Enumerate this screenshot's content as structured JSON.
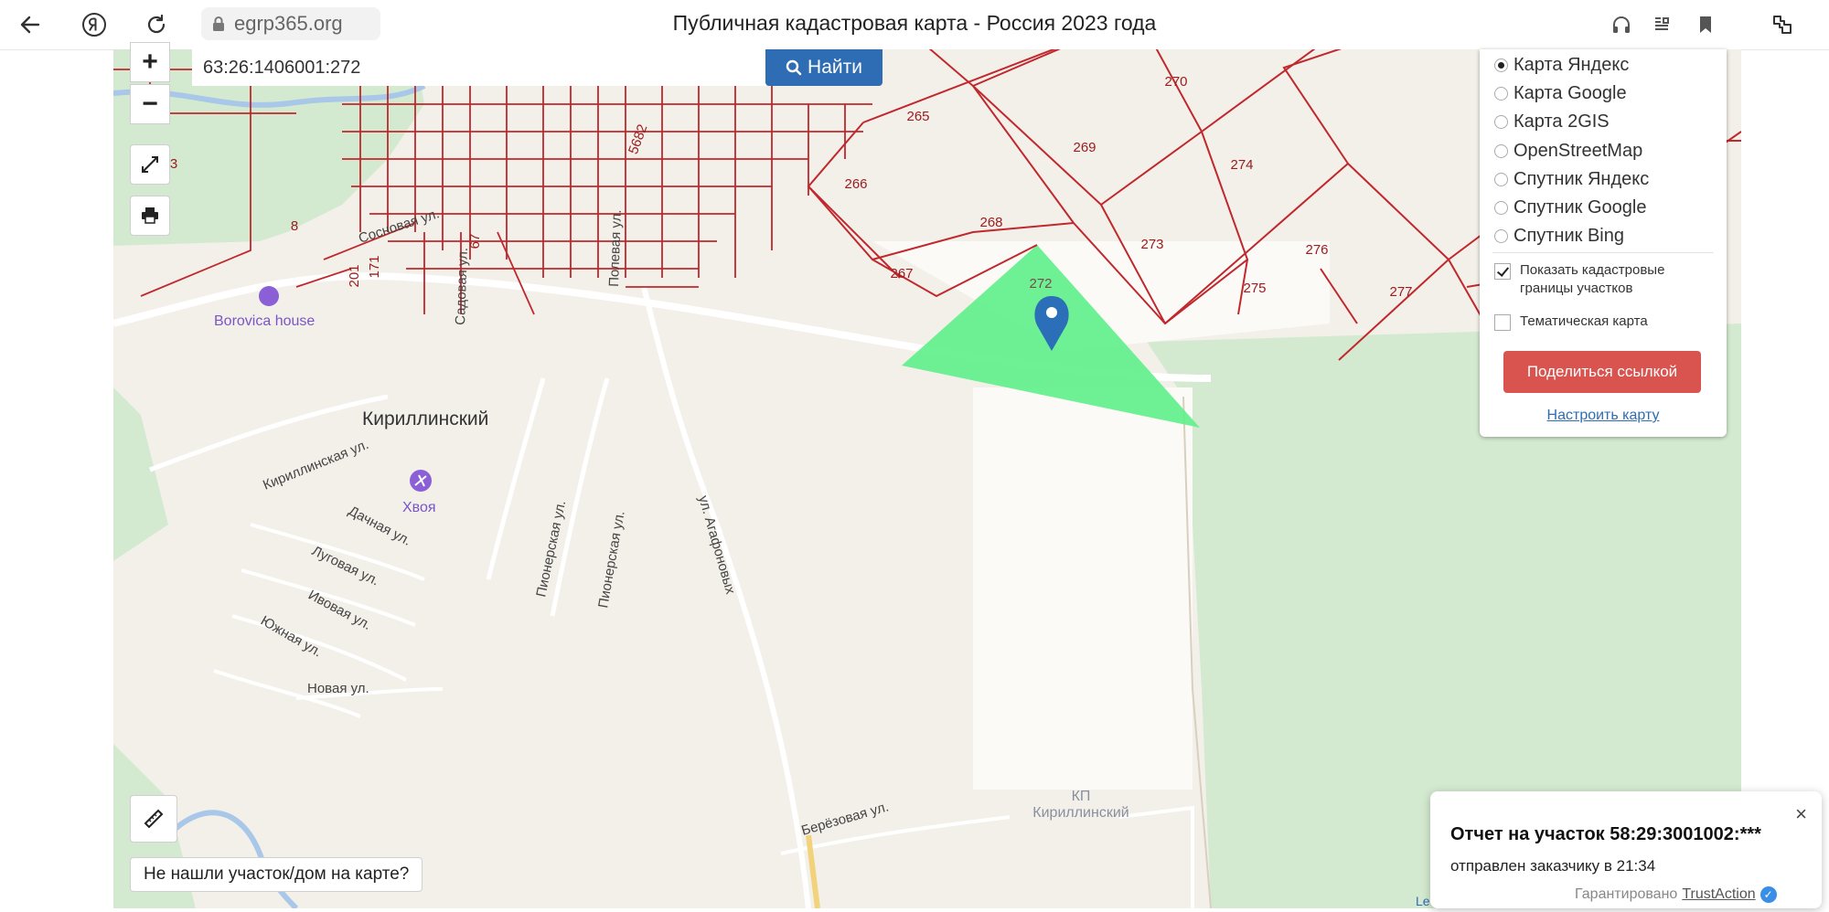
{
  "browser": {
    "domain": "egrp365.org",
    "page_title": "Публичная кадастровая карта - Россия 2023 года",
    "icons": [
      "back-arrow-icon",
      "yandex-icon",
      "reload-icon",
      "lock-icon",
      "headphones-icon",
      "reader-icon",
      "bookmark-icon",
      "extensions-icon"
    ]
  },
  "search": {
    "value": "63:26:1406001:272",
    "button_label": "Найти"
  },
  "zoom": {
    "in": "+",
    "out": "−"
  },
  "layers": {
    "options": [
      "Карта Яндекс",
      "Карта Google",
      "Карта 2GIS",
      "OpenStreetMap",
      "Спутник Яндекс",
      "Спутник Google",
      "Спутник Bing"
    ],
    "selected_index": 0,
    "show_cadastral_label": "Показать кадастровые границы участков",
    "show_cadastral_checked": true,
    "thematic_label": "Тематическая карта",
    "thematic_checked": false,
    "share_button": "Поделиться ссылкой",
    "setup_link": "Настроить карту"
  },
  "map_labels": {
    "parcels": [
      "265",
      "266",
      "267",
      "268",
      "269",
      "270",
      "273",
      "274",
      "275",
      "276",
      "277",
      "272",
      "8",
      "3",
      "5682",
      "67",
      "201",
      "171"
    ],
    "streets": [
      "Сосновая ул.",
      "Кириллинская ул.",
      "Дачная ул.",
      "Луговая ул.",
      "Ивовая ул.",
      "Южная ул.",
      "Новая ул.",
      "Пионерская ул.",
      "Пионерская ул.",
      "ул. Агафоновых",
      "Берёзовая ул.",
      "Полевая ул.",
      "Садовая ул."
    ],
    "places": {
      "settlement": "Кириллинский",
      "poi1": "Borovica house",
      "poi2": "Хвоя",
      "kp_line1": "КП",
      "kp_line2": "Кириллинский"
    },
    "attribution": "Le"
  },
  "not_found_button": "Не нашли участок/дом на карте?",
  "notification": {
    "title": "Отчет на участок 58:29:3001002:***",
    "subtitle": "отправлен заказчику в 21:34",
    "footer_prefix": "Гарантировано",
    "footer_brand": "TrustAction",
    "close": "×"
  },
  "colors": {
    "parcel_border": "#c0282d",
    "selected_parcel": "#5ef08a",
    "forest": "#d4ead0",
    "marker": "#2a6fb8",
    "accent_button": "#2e6db4",
    "share_button": "#d9534f"
  }
}
